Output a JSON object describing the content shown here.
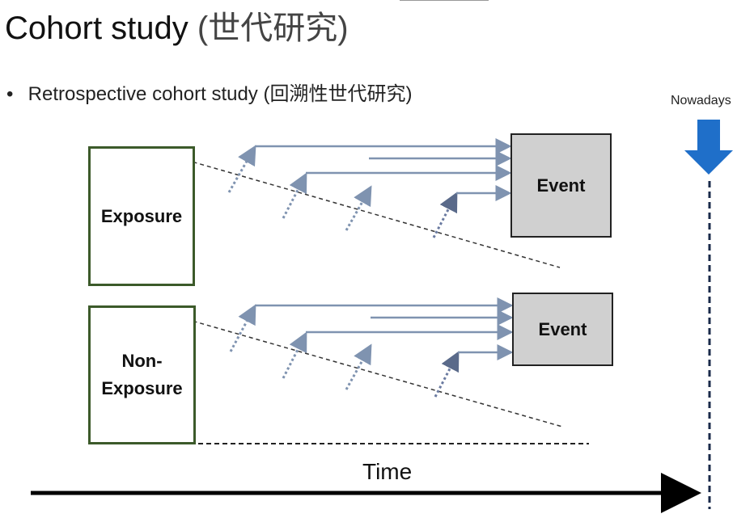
{
  "title": {
    "main": "Cohort study",
    "cn": "(世代研究)"
  },
  "bullet": {
    "symbol": "•",
    "text": "Retrospective cohort study (回溯性世代研究)"
  },
  "nowadays_label": "Nowadays",
  "boxes": {
    "exposure": "Exposure",
    "non_exposure_line1": "Non-",
    "non_exposure_line2": "Exposure",
    "event_top": "Event",
    "event_bottom": "Event"
  },
  "time_label": "Time",
  "colors": {
    "box_border": "#3c5a2a",
    "event_fill": "#d0d0d0",
    "arrow": "#7f93b0",
    "nowadays_arrow": "#1f6fc9",
    "dashed": "#1a2a4a"
  }
}
